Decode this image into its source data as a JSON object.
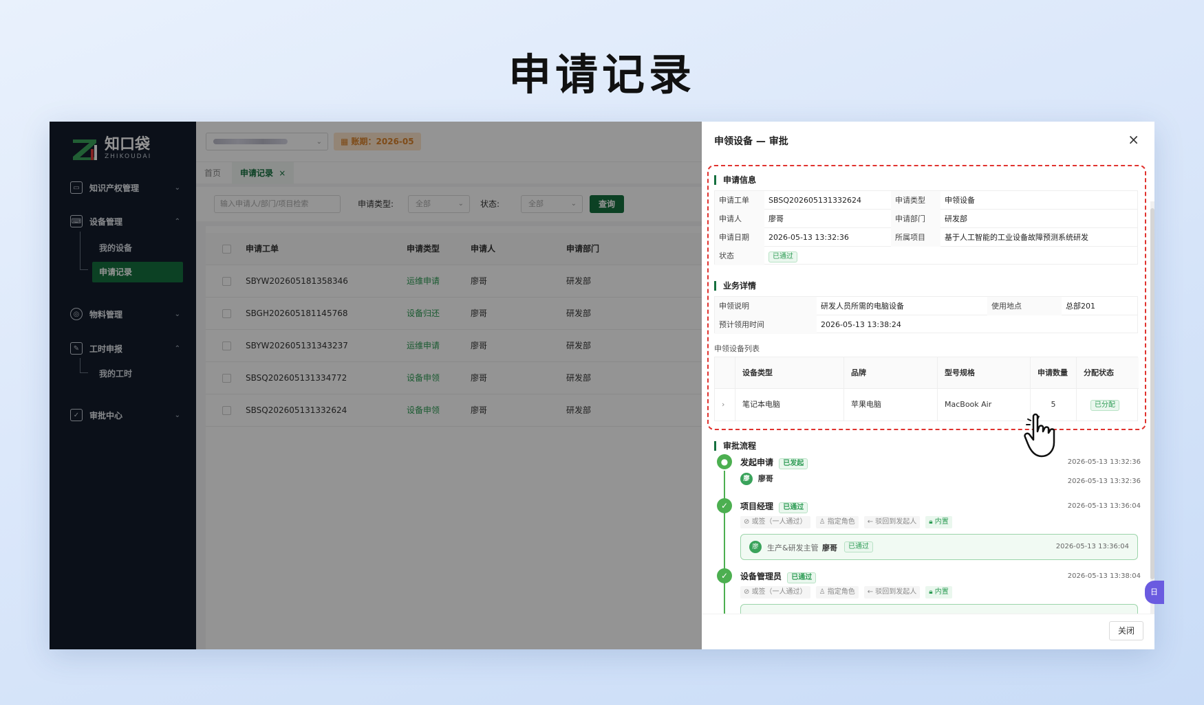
{
  "page_title": "申请记录",
  "app": {
    "logo_cn": "知口袋",
    "logo_en": "ZHIKOUDAI"
  },
  "sidebar": {
    "items": [
      {
        "label": "知识产权管理",
        "chevron": "⌄"
      },
      {
        "label": "设备管理",
        "chevron": "⌃"
      },
      {
        "label": "物料管理",
        "chevron": "⌄"
      },
      {
        "label": "工时申报",
        "chevron": "⌃"
      },
      {
        "label": "审批中心",
        "chevron": "⌄"
      }
    ],
    "sub_items": {
      "my_devices": "我的设备",
      "apply_records": "申请记录",
      "my_hours": "我的工时"
    }
  },
  "topbar": {
    "period": "账期：2026-05"
  },
  "tabs": {
    "home": "首页",
    "active": "申请记录",
    "active_close": "×"
  },
  "filters": {
    "search_placeholder": "输入申请人/部门/项目检索",
    "type_label": "申请类型:",
    "type_value": "全部",
    "status_label": "状态:",
    "status_value": "全部",
    "query_button": "查询"
  },
  "table": {
    "headers": [
      "申请工单",
      "申请类型",
      "申请人",
      "申请部门"
    ],
    "rows": [
      [
        "SBYW202605181358346",
        "运维申请",
        "廖哥",
        "研发部"
      ],
      [
        "SBGH202605181145768",
        "设备归还",
        "廖哥",
        "研发部"
      ],
      [
        "SBYW202605131343237",
        "运维申请",
        "廖哥",
        "研发部"
      ],
      [
        "SBSQ202605131334772",
        "设备申领",
        "廖哥",
        "研发部"
      ],
      [
        "SBSQ202605131332624",
        "设备申领",
        "廖哥",
        "研发部"
      ]
    ]
  },
  "drawer": {
    "title": "申领设备 — 审批",
    "close_icon": "×",
    "apply_info_title": "申请信息",
    "apply_info": {
      "order_label": "申请工单",
      "order": "SBSQ202605131332624",
      "type_label": "申请类型",
      "type": "申领设备",
      "applicant_label": "申请人",
      "applicant": "廖哥",
      "dept_label": "申请部门",
      "dept": "研发部",
      "date_label": "申请日期",
      "date": "2026-05-13 13:32:36",
      "project_label": "所属项目",
      "project": "基于人工智能的工业设备故障预测系统研发",
      "status_label": "状态",
      "status": "已通过"
    },
    "biz_title": "业务详情",
    "biz": {
      "desc_label": "申领说明",
      "desc": "研发人员所需的电脑设备",
      "place_label": "使用地点",
      "place": "总部201",
      "time_label": "预计领用时间",
      "time": "2026-05-13 13:38:24"
    },
    "equipment_list_label": "申领设备列表",
    "equipment_headers": [
      "设备类型",
      "品牌",
      "型号规格",
      "申请数量",
      "分配状态"
    ],
    "equipment_rows": [
      {
        "expand": "›",
        "type": "笔记本电脑",
        "brand": "苹果电脑",
        "model": "MacBook Air",
        "qty": "5",
        "status": "已分配"
      }
    ],
    "flow_title": "审批流程",
    "flow": {
      "s1_title": "发起申请",
      "s1_tag": "已发起",
      "s1_time": "2026-05-13 13:32:36",
      "s1_avatar": "廖",
      "s1_user": "廖哥",
      "s1_user_time": "2026-05-13 13:32:36",
      "s2_title": "项目经理",
      "s2_tag": "已通过",
      "s2_time": "2026-05-13 13:36:04",
      "s2_chips": [
        "或签（一人通过）",
        "指定角色",
        "驳回到发起人",
        "内置"
      ],
      "s2_card_role": "生产&研发主管",
      "s2_card_user": "廖哥",
      "s2_card_tag": "已通过",
      "s2_card_time": "2026-05-13 13:36:04",
      "s3_title": "设备管理员",
      "s3_tag": "已通过",
      "s3_time": "2026-05-13 13:38:04",
      "s3_chips": [
        "或签（一人通过）",
        "指定角色",
        "驳回到发起人",
        "内置"
      ]
    },
    "close_button": "关闭"
  },
  "float_button": "日",
  "colors": {
    "brand_green": "#15703f",
    "success_green": "#4caf50",
    "highlight_red": "#e0322e",
    "accent_purple": "#6a5be0"
  }
}
